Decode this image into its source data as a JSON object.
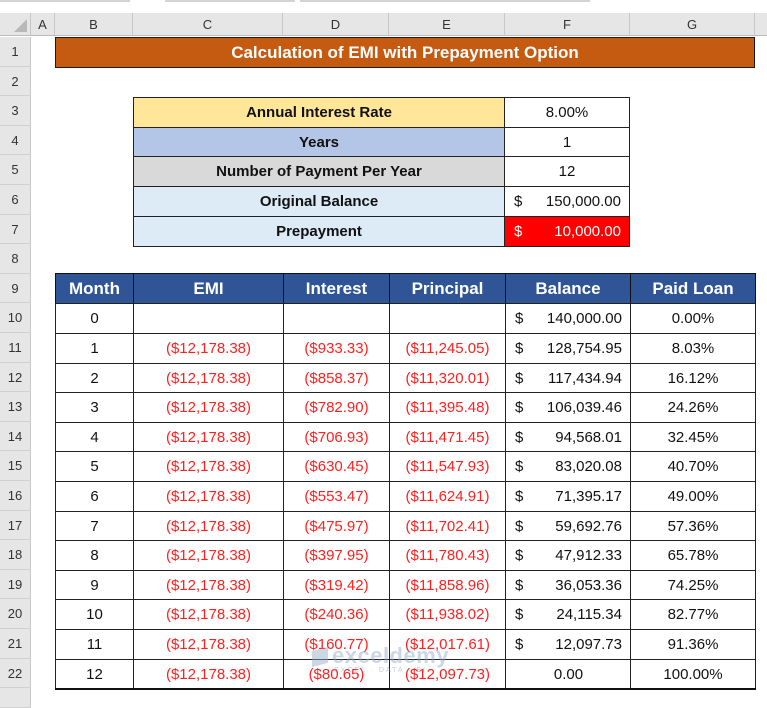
{
  "spreadsheet": {
    "column_headers": [
      "A",
      "B",
      "C",
      "D",
      "E",
      "F",
      "G"
    ],
    "row_headers": [
      "1",
      "2",
      "3",
      "4",
      "5",
      "6",
      "7",
      "8",
      "9",
      "10",
      "11",
      "12",
      "13",
      "14",
      "15",
      "16",
      "17",
      "18",
      "19",
      "20",
      "21",
      "22"
    ]
  },
  "title": "Calculation of EMI with Prepayment Option",
  "inputs": [
    {
      "label": "Annual Interest Rate",
      "value": "8.00%",
      "label_bg": "#ffe699"
    },
    {
      "label": "Years",
      "value": "1",
      "label_bg": "#b4c6e7"
    },
    {
      "label": "Number of Payment Per Year",
      "value": "12",
      "label_bg": "#d9d9d9"
    },
    {
      "label": "Original Balance",
      "currency": "$",
      "value": "150,000.00",
      "label_bg": "#ddebf7"
    },
    {
      "label": "Prepayment",
      "currency": "$",
      "value": "10,000.00",
      "label_bg": "#ddebf7",
      "value_bg": "#ff0000"
    }
  ],
  "table": {
    "headers": [
      "Month",
      "EMI",
      "Interest",
      "Principal",
      "Balance",
      "Paid Loan"
    ],
    "header_bg": "#2f5597",
    "rows": [
      {
        "month": "0",
        "emi": "",
        "interest": "",
        "principal": "",
        "balance_cur": "$",
        "balance": "140,000.00",
        "paid": "0.00%"
      },
      {
        "month": "1",
        "emi": "($12,178.38)",
        "interest": "($933.33)",
        "principal": "($11,245.05)",
        "balance_cur": "$",
        "balance": "128,754.95",
        "paid": "8.03%"
      },
      {
        "month": "2",
        "emi": "($12,178.38)",
        "interest": "($858.37)",
        "principal": "($11,320.01)",
        "balance_cur": "$",
        "balance": "117,434.94",
        "paid": "16.12%"
      },
      {
        "month": "3",
        "emi": "($12,178.38)",
        "interest": "($782.90)",
        "principal": "($11,395.48)",
        "balance_cur": "$",
        "balance": "106,039.46",
        "paid": "24.26%"
      },
      {
        "month": "4",
        "emi": "($12,178.38)",
        "interest": "($706.93)",
        "principal": "($11,471.45)",
        "balance_cur": "$",
        "balance": "94,568.01",
        "paid": "32.45%"
      },
      {
        "month": "5",
        "emi": "($12,178.38)",
        "interest": "($630.45)",
        "principal": "($11,547.93)",
        "balance_cur": "$",
        "balance": "83,020.08",
        "paid": "40.70%"
      },
      {
        "month": "6",
        "emi": "($12,178.38)",
        "interest": "($553.47)",
        "principal": "($11,624.91)",
        "balance_cur": "$",
        "balance": "71,395.17",
        "paid": "49.00%"
      },
      {
        "month": "7",
        "emi": "($12,178.38)",
        "interest": "($475.97)",
        "principal": "($11,702.41)",
        "balance_cur": "$",
        "balance": "59,692.76",
        "paid": "57.36%"
      },
      {
        "month": "8",
        "emi": "($12,178.38)",
        "interest": "($397.95)",
        "principal": "($11,780.43)",
        "balance_cur": "$",
        "balance": "47,912.33",
        "paid": "65.78%"
      },
      {
        "month": "9",
        "emi": "($12,178.38)",
        "interest": "($319.42)",
        "principal": "($11,858.96)",
        "balance_cur": "$",
        "balance": "36,053.36",
        "paid": "74.25%"
      },
      {
        "month": "10",
        "emi": "($12,178.38)",
        "interest": "($240.36)",
        "principal": "($11,938.02)",
        "balance_cur": "$",
        "balance": "24,115.34",
        "paid": "82.77%"
      },
      {
        "month": "11",
        "emi": "($12,178.38)",
        "interest": "($160.77)",
        "principal": "($12,017.61)",
        "balance_cur": "$",
        "balance": "12,097.73",
        "paid": "91.36%"
      },
      {
        "month": "12",
        "emi": "($12,178.38)",
        "interest": "($80.65)",
        "principal": "($12,097.73)",
        "balance_cur": "",
        "balance": "0.00",
        "paid": "100.00%"
      }
    ]
  },
  "watermark": {
    "brand": "exceldemy",
    "tagline": "EXCEL · DATA · BI"
  }
}
